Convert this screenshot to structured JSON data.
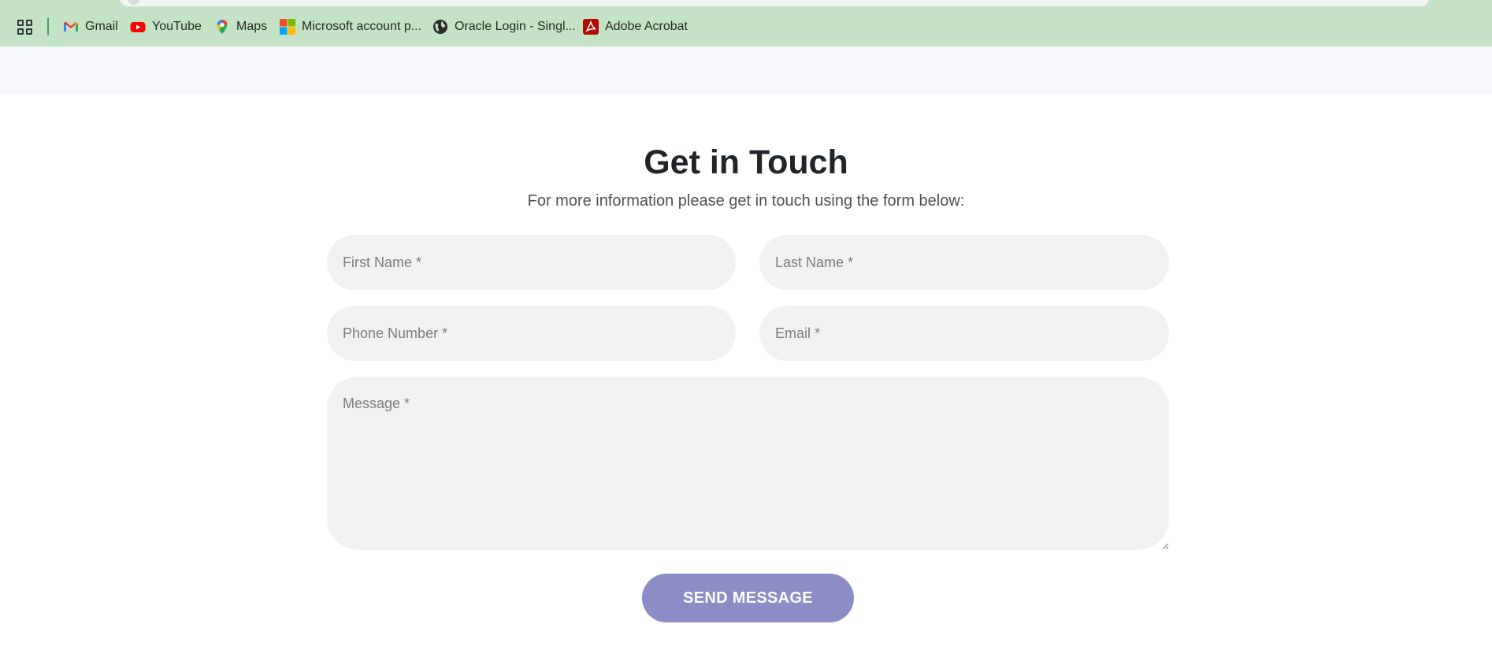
{
  "bookmarks": [
    {
      "label": "Gmail",
      "icon": "gmail-icon"
    },
    {
      "label": "YouTube",
      "icon": "youtube-icon"
    },
    {
      "label": "Maps",
      "icon": "maps-icon"
    },
    {
      "label": "Microsoft account p...",
      "icon": "microsoft-icon"
    },
    {
      "label": "Oracle Login - Singl...",
      "icon": "globe-icon"
    },
    {
      "label": "Adobe Acrobat",
      "icon": "acrobat-icon"
    }
  ],
  "contact": {
    "title": "Get in Touch",
    "subtitle": "For more information please get in touch using the form below:",
    "fields": {
      "first_name": "First Name *",
      "last_name": "Last Name *",
      "phone": "Phone Number *",
      "email": "Email *",
      "message": "Message *"
    },
    "submit_label": "SEND MESSAGE"
  },
  "colors": {
    "bookmarks_bar": "#c4e3c6",
    "header_strip": "#f6f8fc",
    "field_bg": "#f1f1f1",
    "button_bg": "#8c8cc6",
    "title": "#212529"
  }
}
